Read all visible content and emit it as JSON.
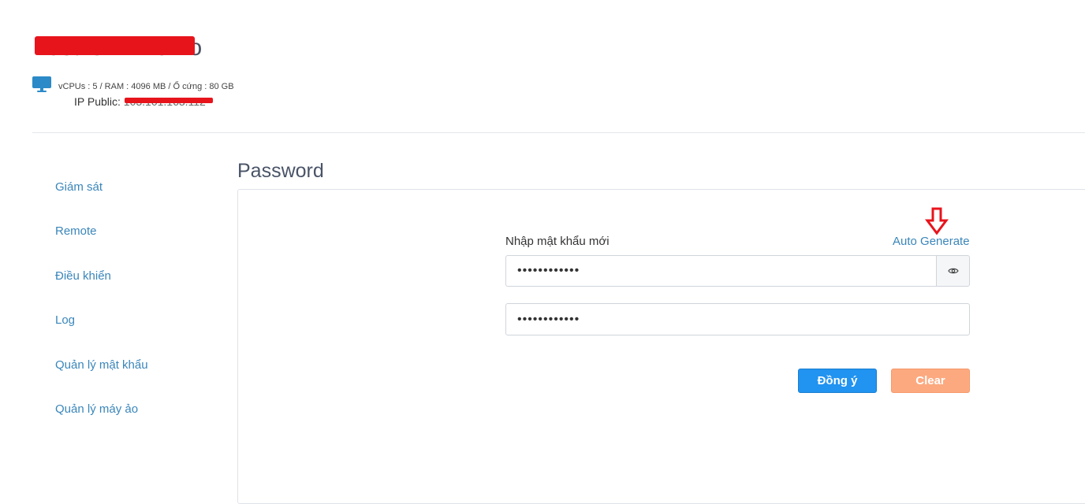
{
  "vm": {
    "title": "Test-CTRDemo",
    "specs": "vCPUs : 5 / RAM : 4096 MB / Ổ cứng : 80 GB",
    "ip_label": "IP Public:",
    "ip_value": "103.101.163.112"
  },
  "sidebar": {
    "items": [
      {
        "label": "Giám sát"
      },
      {
        "label": "Remote"
      },
      {
        "label": "Điều khiển"
      },
      {
        "label": "Log"
      },
      {
        "label": "Quản lý mật khẩu"
      },
      {
        "label": "Quản lý máy ảo"
      }
    ]
  },
  "password_section": {
    "title": "Password",
    "new_password_label": "Nhập mật khẩu mới",
    "auto_generate_label": "Auto Generate",
    "password_value": "••••••••••••",
    "confirm_value": "••••••••••••",
    "submit_label": "Đồng ý",
    "clear_label": "Clear"
  },
  "colors": {
    "link": "#3a86ba",
    "primary_button": "#2193f0",
    "clear_button": "#fda97f",
    "annotation": "#e8141c"
  },
  "icons": {
    "monitor": "monitor-icon",
    "eye": "eye-icon",
    "annotation_arrow": "down-arrow-icon"
  }
}
